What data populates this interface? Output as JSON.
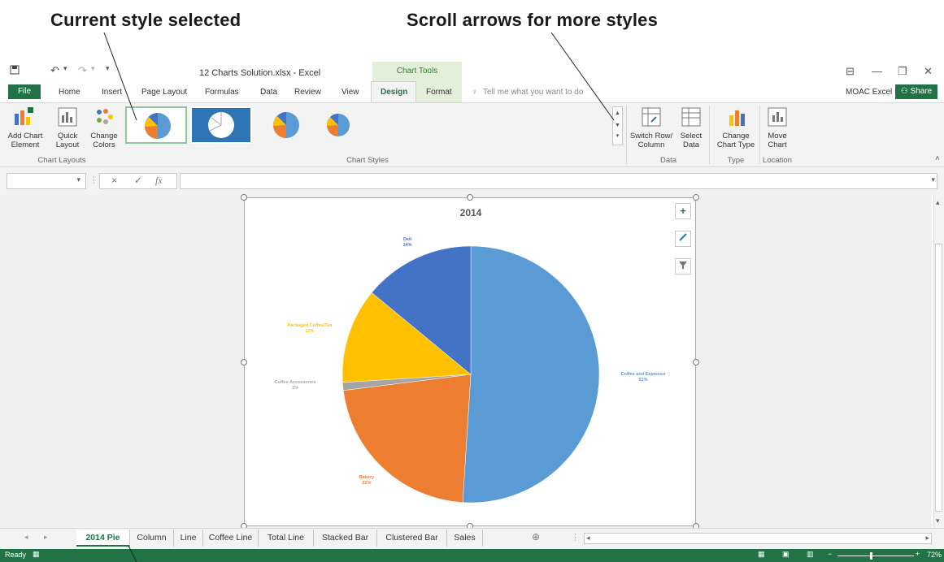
{
  "callouts": {
    "current_style": "Current style selected",
    "scroll_arrows": "Scroll arrows for more styles"
  },
  "titlebar": {
    "file_title": "12 Charts Solution.xlsx - Excel",
    "chart_tools": "Chart Tools"
  },
  "tabs": {
    "file": "File",
    "home": "Home",
    "insert": "Insert",
    "page_layout": "Page Layout",
    "formulas": "Formulas",
    "data": "Data",
    "review": "Review",
    "view": "View",
    "design": "Design",
    "format": "Format",
    "tell_me": "Tell me what you want to do",
    "account": "MOAC Excel",
    "share": "Share"
  },
  "ribbon": {
    "add_chart_element": "Add Chart Element",
    "quick_layout": "Quick Layout",
    "change_colors": "Change Colors",
    "chart_layouts_group": "Chart Layouts",
    "chart_styles_group": "Chart Styles",
    "switch_row_column": "Switch Row/ Column",
    "select_data": "Select Data",
    "data_group": "Data",
    "change_chart_type": "Change Chart Type",
    "type_group": "Type",
    "move_chart": "Move Chart",
    "location_group": "Location"
  },
  "formula_bar": {
    "fx": "fx",
    "cancel": "×",
    "enter": "✓"
  },
  "chart_data": {
    "type": "pie",
    "title": "2014",
    "categories": [
      "Coffee and Espresso",
      "Bakery",
      "Coffee Accessories",
      "Packaged Coffee/Tea",
      "Deli"
    ],
    "values": [
      51,
      22,
      1,
      12,
      14
    ],
    "data_labels": [
      "Coffee and Espresso\n51%",
      "Bakery\n22%",
      "Coffee Accessories\n1%",
      "Packaged Coffee/Tea\n12%",
      "Deli\n14%"
    ],
    "colors": [
      "#5b9bd5",
      "#ed7d31",
      "#a5a5a5",
      "#ffc000",
      "#4472c4"
    ],
    "legend": "none"
  },
  "sheet_tabs": [
    "2014 Pie",
    "Column",
    "Line",
    "Coffee Line",
    "Total Line",
    "Stacked Bar",
    "Clustered Bar",
    "Sales"
  ],
  "status": {
    "ready": "Ready",
    "zoom": "72%"
  },
  "colors": {
    "excel_green": "#217346",
    "chart_tools_bg": "#e2f0d9",
    "selected_style_border": "#8fc79a"
  }
}
